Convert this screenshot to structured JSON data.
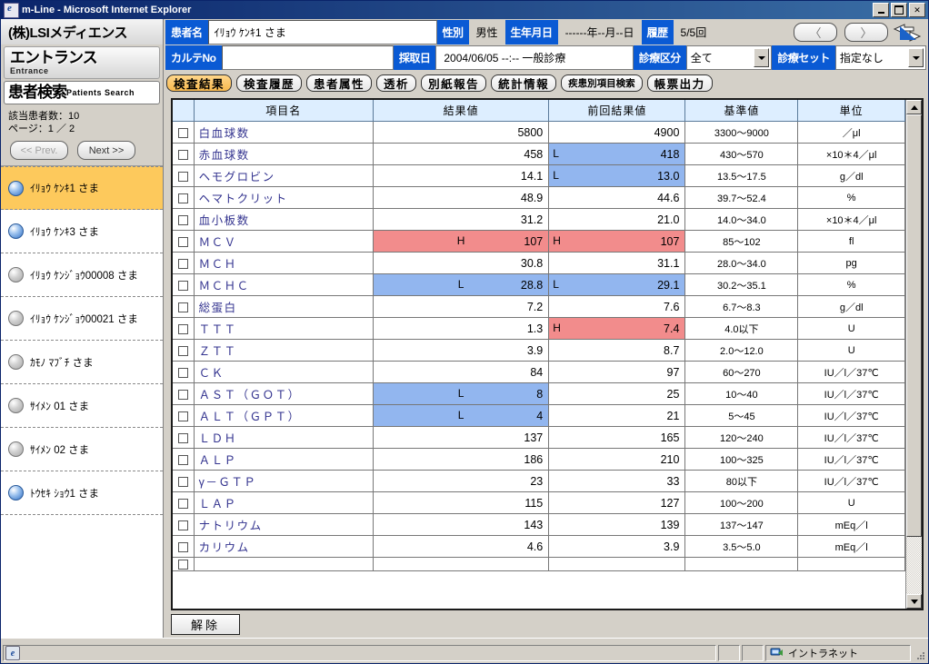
{
  "window": {
    "title": "m-Line - Microsoft Internet Explorer",
    "minimize_label": "_",
    "maximize_label": "□",
    "close_label": "✕"
  },
  "sidebar": {
    "brand": "(株)LSIメディエンス",
    "nav": [
      {
        "jp": "エントランス",
        "en": "Entrance"
      },
      {
        "jp": "患者検索",
        "en": "Patients Search"
      }
    ],
    "patient_count_label": "該当患者数：10",
    "page_label": "ページ：1 ／ 2",
    "prev_label": "<< Prev.",
    "next_label": "Next >>",
    "patients": [
      {
        "name": "ｲﾘｮｳ ｹﾝｷ1 さま",
        "active": true,
        "dot": "on"
      },
      {
        "name": "ｲﾘｮｳ ｹﾝｷ3 さま",
        "active": false,
        "dot": "on"
      },
      {
        "name": "ｲﾘｮｳ ｹﾝｼﾞｮｳ00008 さま",
        "active": false,
        "dot": "off"
      },
      {
        "name": "ｲﾘｮｳ ｹﾝｼﾞｮｳ00021 さま",
        "active": false,
        "dot": "off"
      },
      {
        "name": "ｶﾓﾉ ﾏﾌﾞﾁ さま",
        "active": false,
        "dot": "off"
      },
      {
        "name": "ｻｲﾒﾝ 01 さま",
        "active": false,
        "dot": "off"
      },
      {
        "name": "ｻｲﾒﾝ 02 さま",
        "active": false,
        "dot": "off"
      },
      {
        "name": "ﾄｳｾｷ ｼｮｳ1 さま",
        "active": false,
        "dot": "on"
      }
    ]
  },
  "header": {
    "patient_name_label": "患者名",
    "patient_name_value": "ｲﾘｮｳ ｹﾝｷ1 さま",
    "gender_label": "性別",
    "gender_value": "男性",
    "birth_label": "生年月日",
    "birth_value": "------年--月--日",
    "history_label": "履歴",
    "history_value": "5/5回",
    "prev_arrow": "〈",
    "next_arrow": "〉",
    "karte_label": "カルテNo",
    "karte_value": "",
    "sample_date_label": "採取日",
    "sample_date_value": "2004/06/05  --:--  一般診療",
    "division_label": "診療区分",
    "division_value": "全て",
    "set_label": "診療セット",
    "set_value": "指定なし"
  },
  "tabs": [
    {
      "label": "検査結果",
      "active": true,
      "small": false
    },
    {
      "label": "検査履歴",
      "active": false,
      "small": false
    },
    {
      "label": "患者属性",
      "active": false,
      "small": false
    },
    {
      "label": "透析",
      "active": false,
      "small": false
    },
    {
      "label": "別紙報告",
      "active": false,
      "small": false
    },
    {
      "label": "統計情報",
      "active": false,
      "small": false
    },
    {
      "label": "疾患別項目検索",
      "active": false,
      "small": true
    },
    {
      "label": "帳票出力",
      "active": false,
      "small": false
    }
  ],
  "table": {
    "columns": [
      "",
      "項目名",
      "結果値",
      "前回結果値",
      "基準値",
      "単位"
    ],
    "rows": [
      {
        "name": "白血球数",
        "result": "5800",
        "result_flag": "",
        "result_state": "",
        "prev": "4900",
        "prev_flag": "",
        "prev_state": "",
        "ref": "3300～9000",
        "unit": "／μl"
      },
      {
        "name": "赤血球数",
        "result": "458",
        "result_flag": "",
        "result_state": "",
        "prev": "418",
        "prev_flag": "L",
        "prev_state": "lo",
        "ref": "430～570",
        "unit": "×10＊4／μl"
      },
      {
        "name": "ヘモグロビン",
        "result": "14.1",
        "result_flag": "",
        "result_state": "",
        "prev": "13.0",
        "prev_flag": "L",
        "prev_state": "lo",
        "ref": "13.5～17.5",
        "unit": "g／dl"
      },
      {
        "name": "ヘマトクリット",
        "result": "48.9",
        "result_flag": "",
        "result_state": "",
        "prev": "44.6",
        "prev_flag": "",
        "prev_state": "",
        "ref": "39.7～52.4",
        "unit": "%"
      },
      {
        "name": "血小板数",
        "result": "31.2",
        "result_flag": "",
        "result_state": "",
        "prev": "21.0",
        "prev_flag": "",
        "prev_state": "",
        "ref": "14.0～34.0",
        "unit": "×10＊4／μl"
      },
      {
        "name": "ＭＣＶ",
        "result": "107",
        "result_flag": "H",
        "result_state": "hi",
        "prev": "107",
        "prev_flag": "H",
        "prev_state": "hi",
        "ref": "85～102",
        "unit": "fl"
      },
      {
        "name": "ＭＣＨ",
        "result": "30.8",
        "result_flag": "",
        "result_state": "",
        "prev": "31.1",
        "prev_flag": "",
        "prev_state": "",
        "ref": "28.0～34.0",
        "unit": "pg"
      },
      {
        "name": "ＭＣＨＣ",
        "result": "28.8",
        "result_flag": "L",
        "result_state": "lo",
        "prev": "29.1",
        "prev_flag": "L",
        "prev_state": "lo",
        "ref": "30.2～35.1",
        "unit": "%"
      },
      {
        "name": "総蛋白",
        "result": "7.2",
        "result_flag": "",
        "result_state": "",
        "prev": "7.6",
        "prev_flag": "",
        "prev_state": "",
        "ref": "6.7～8.3",
        "unit": "g／dl"
      },
      {
        "name": "ＴＴＴ",
        "result": "1.3",
        "result_flag": "",
        "result_state": "",
        "prev": "7.4",
        "prev_flag": "H",
        "prev_state": "hi",
        "ref": "4.0以下",
        "unit": "U"
      },
      {
        "name": "ＺＴＴ",
        "result": "3.9",
        "result_flag": "",
        "result_state": "",
        "prev": "8.7",
        "prev_flag": "",
        "prev_state": "",
        "ref": "2.0～12.0",
        "unit": "U"
      },
      {
        "name": "ＣＫ",
        "result": "84",
        "result_flag": "",
        "result_state": "",
        "prev": "97",
        "prev_flag": "",
        "prev_state": "",
        "ref": "60～270",
        "unit": "IU／l／37℃"
      },
      {
        "name": "ＡＳＴ（ＧＯＴ）",
        "result": "8",
        "result_flag": "L",
        "result_state": "lo",
        "prev": "25",
        "prev_flag": "",
        "prev_state": "",
        "ref": "10～40",
        "unit": "IU／l／37℃"
      },
      {
        "name": "ＡＬＴ（ＧＰＴ）",
        "result": "4",
        "result_flag": "L",
        "result_state": "lo",
        "prev": "21",
        "prev_flag": "",
        "prev_state": "",
        "ref": "5～45",
        "unit": "IU／l／37℃"
      },
      {
        "name": "ＬＤＨ",
        "result": "137",
        "result_flag": "",
        "result_state": "",
        "prev": "165",
        "prev_flag": "",
        "prev_state": "",
        "ref": "120～240",
        "unit": "IU／l／37℃"
      },
      {
        "name": "ＡＬＰ",
        "result": "186",
        "result_flag": "",
        "result_state": "",
        "prev": "210",
        "prev_flag": "",
        "prev_state": "",
        "ref": "100～325",
        "unit": "IU／l／37℃"
      },
      {
        "name": "γ－ＧＴＰ",
        "result": "23",
        "result_flag": "",
        "result_state": "",
        "prev": "33",
        "prev_flag": "",
        "prev_state": "",
        "ref": "80以下",
        "unit": "IU／l／37℃"
      },
      {
        "name": "ＬＡＰ",
        "result": "115",
        "result_flag": "",
        "result_state": "",
        "prev": "127",
        "prev_flag": "",
        "prev_state": "",
        "ref": "100～200",
        "unit": "U"
      },
      {
        "name": "ナトリウム",
        "result": "143",
        "result_flag": "",
        "result_state": "",
        "prev": "139",
        "prev_flag": "",
        "prev_state": "",
        "ref": "137～147",
        "unit": "mEq／l"
      },
      {
        "name": "カリウム",
        "result": "4.6",
        "result_flag": "",
        "result_state": "",
        "prev": "3.9",
        "prev_flag": "",
        "prev_state": "",
        "ref": "3.5～5.0",
        "unit": "mEq／l"
      }
    ],
    "clear_button": "解除"
  },
  "status": {
    "zone": "イントラネット"
  }
}
